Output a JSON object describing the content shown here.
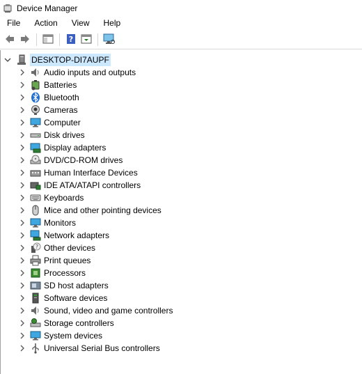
{
  "window": {
    "title": "Device Manager"
  },
  "menu": [
    "File",
    "Action",
    "View",
    "Help"
  ],
  "toolbar": {
    "buttons": [
      "back-arrow-icon",
      "forward-arrow-icon",
      "show-hide-tree-icon",
      "help-icon",
      "properties-icon",
      "scan-hardware-icon"
    ]
  },
  "tree": {
    "root": {
      "label": "DESKTOP-DI7AUPF",
      "expanded": true
    },
    "categories": [
      {
        "label": "Audio inputs and outputs",
        "icon": "speaker-icon"
      },
      {
        "label": "Batteries",
        "icon": "battery-icon"
      },
      {
        "label": "Bluetooth",
        "icon": "bluetooth-icon"
      },
      {
        "label": "Cameras",
        "icon": "camera-icon"
      },
      {
        "label": "Computer",
        "icon": "computer-icon"
      },
      {
        "label": "Disk drives",
        "icon": "disk-drive-icon"
      },
      {
        "label": "Display adapters",
        "icon": "display-adapter-icon"
      },
      {
        "label": "DVD/CD-ROM drives",
        "icon": "dvd-icon"
      },
      {
        "label": "Human Interface Devices",
        "icon": "hid-icon"
      },
      {
        "label": "IDE ATA/ATAPI controllers",
        "icon": "ide-controller-icon"
      },
      {
        "label": "Keyboards",
        "icon": "keyboard-icon"
      },
      {
        "label": "Mice and other pointing devices",
        "icon": "mouse-icon"
      },
      {
        "label": "Monitors",
        "icon": "monitor-icon"
      },
      {
        "label": "Network adapters",
        "icon": "network-adapter-icon"
      },
      {
        "label": "Other devices",
        "icon": "other-devices-icon"
      },
      {
        "label": "Print queues",
        "icon": "printer-icon"
      },
      {
        "label": "Processors",
        "icon": "processor-icon"
      },
      {
        "label": "SD host adapters",
        "icon": "sd-host-icon"
      },
      {
        "label": "Software devices",
        "icon": "software-device-icon"
      },
      {
        "label": "Sound, video and game controllers",
        "icon": "sound-controller-icon"
      },
      {
        "label": "Storage controllers",
        "icon": "storage-controller-icon"
      },
      {
        "label": "System devices",
        "icon": "system-devices-icon"
      },
      {
        "label": "Universal Serial Bus controllers",
        "icon": "usb-icon"
      }
    ]
  }
}
